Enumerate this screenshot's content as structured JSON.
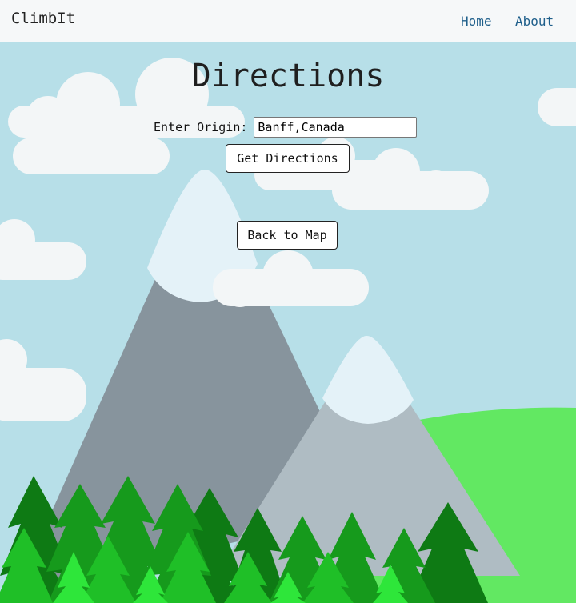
{
  "navbar": {
    "brand": "ClimbIt",
    "links": [
      "Home",
      "About"
    ]
  },
  "page": {
    "title": "Directions"
  },
  "form": {
    "origin_label": "Enter Origin:",
    "origin_value": "Banff,Canada",
    "get_directions_label": "Get Directions",
    "back_label": "Back to Map"
  },
  "colors": {
    "sky": "#b7dfe8",
    "cloud": "#f3f6f7",
    "mountain_dark": "#87949d",
    "mountain_light": "#afbcc3",
    "snow": "#e4f2f8",
    "grass": "#62e862",
    "link": "#1f5f8b"
  }
}
